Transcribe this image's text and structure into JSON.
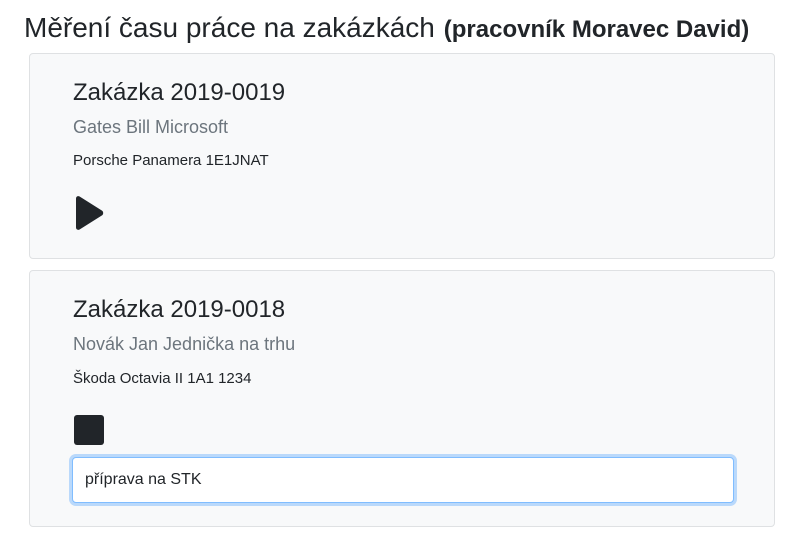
{
  "header": {
    "title": "Měření času práce na zakázkách",
    "subtitle": "(pracovník Moravec David)"
  },
  "orders": [
    {
      "title": "Zakázka 2019-0019",
      "customer": "Gates Bill Microsoft",
      "vehicle": "Porsche Panamera 1E1JNAT",
      "control_icon": "play-icon",
      "timer_state": "stopped"
    },
    {
      "title": "Zakázka 2019-0018",
      "customer": "Novák Jan Jednička na trhu",
      "vehicle": "Škoda Octavia II 1A1 1234",
      "control_icon": "stop-icon",
      "timer_state": "running",
      "note_value": "příprava na STK"
    }
  ],
  "colors": {
    "card_background": "#f8f9fa",
    "subtitle_text": "#6c757d",
    "icon_fill": "#212529",
    "focus_border": "#80bdff"
  }
}
